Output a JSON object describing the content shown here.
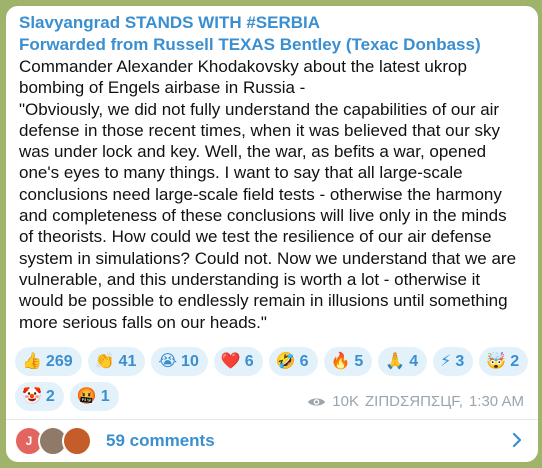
{
  "post": {
    "channel_name": "Slavyangrad STANDS WITH #SERBIA",
    "forwarded_from": "Forwarded from Russell TEXAS Bentley (Texac Donbass)",
    "text": "Commander Alexander Khodakovsky about the latest ukrop\nbombing of Engels airbase in Russia -\n\"Obviously, we did not fully understand the capabilities of our air\ndefense in those recent times, when it was believed that our sky\nwas under lock and key. Well, the war, as befits a war, opened\none's eyes to many things. I want to say that all large-scale\nconclusions need large-scale field tests - otherwise the harmony\nand completeness of these conclusions will live only in the minds\nof theorists. How could we test the resilience of our air defense\nsystem in simulations? Could not. Now we understand that we are\nvulnerable, and this understanding is worth a lot - otherwise it\nwould be possible to endlessly remain in illusions until something\nmore serious falls on our heads.\""
  },
  "reactions": [
    {
      "emoji": "👍",
      "count": "269"
    },
    {
      "emoji": "👏",
      "count": "41"
    },
    {
      "emoji": "😭",
      "count": "10"
    },
    {
      "emoji": "❤️",
      "count": "6"
    },
    {
      "emoji": "🤣",
      "count": "6"
    },
    {
      "emoji": "🔥",
      "count": "5"
    },
    {
      "emoji": "🙏",
      "count": "4"
    },
    {
      "emoji": "⚡",
      "count": "3"
    },
    {
      "emoji": "🤯",
      "count": "2"
    },
    {
      "emoji": "🤡",
      "count": "2"
    },
    {
      "emoji": "🤬",
      "count": "1"
    }
  ],
  "meta": {
    "views": "10K",
    "author": "ZIΠDΣЯΠΣЦF,",
    "time": "1:30 AM",
    "icon": "eye-icon"
  },
  "comments": {
    "label": "59 comments",
    "avatar_initial": "J",
    "icon": "chevron-right-icon"
  },
  "colors": {
    "accent": "#3a8fd0",
    "reaction_bg": "#e3f1fb",
    "background": "#9fb36a"
  }
}
